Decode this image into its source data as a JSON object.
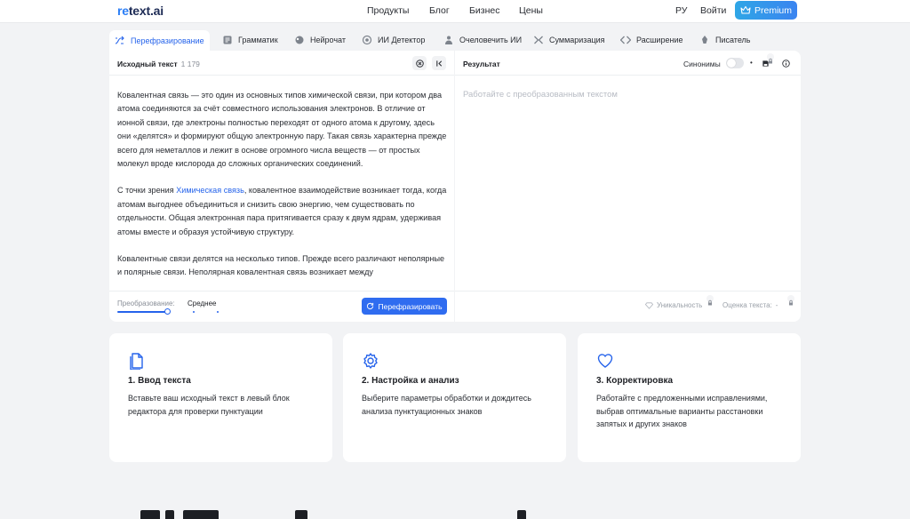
{
  "header": {
    "logo_prefix": "re",
    "logo_rest": "text.ai",
    "nav": [
      "Продукты",
      "Блог",
      "Бизнес",
      "Цены"
    ],
    "lang": "РУ",
    "login": "Войти",
    "premium": "Premium"
  },
  "tabs": [
    {
      "label": "Перефразирование",
      "icon": "paraphrase-icon"
    },
    {
      "label": "Грамматик",
      "icon": "grammar-icon"
    },
    {
      "label": "Нейрочат",
      "icon": "neurochat-icon"
    },
    {
      "label": "ИИ Детектор",
      "icon": "ai-detector-icon"
    },
    {
      "label": "Очеловечить ИИ",
      "icon": "humanize-icon"
    },
    {
      "label": "Суммаризация",
      "icon": "summary-icon"
    },
    {
      "label": "Расширение",
      "icon": "expand-icon"
    },
    {
      "label": "Писатель",
      "icon": "writer-icon"
    }
  ],
  "source": {
    "title": "Исходный текст",
    "count": "1 179",
    "para1": "Ковалентная связь — это один из основных типов химической связи, при котором два атома соединяются за счёт совместного использования электронов. В отличие от ионной связи, где электроны полностью переходят от одного атома к другому, здесь они «делятся» и формируют общую электронную пару. Такая связь характерна прежде всего для неметаллов и лежит в основе огромного числа веществ — от простых молекул вроде кислорода до сложных органических соединений.",
    "para2_before": "С точки зрения ",
    "para2_link": "Химическая связь",
    "para2_after": ", ковалентное взаимодействие возникает тогда, когда атомам выгоднее объединиться и снизить свою энергию, чем существовать по отдельности. Общая электронная пара притягивается сразу к двум ядрам, удерживая атомы вместе и образуя устойчивую структуру.",
    "para3": "Ковалентные связи делятся на несколько типов. Прежде всего различают неполярные и полярные связи. Неполярная ковалентная связь возникает между",
    "mode_label": "Преобразование:",
    "mode_value": "Среднее",
    "mode_level": 0.5,
    "button": "Перефразировать"
  },
  "result": {
    "title": "Результат",
    "synonyms": "Синонимы",
    "placeholder": "Работайте с преобразованным текстом",
    "uniqueness": "Уникальность",
    "score_label": "Оценка текста:",
    "score_value": "-"
  },
  "cards": [
    {
      "title": "1. Ввод текста",
      "desc": "Вставьте ваш исходный текст в левый блок редактора для проверки пунктуации",
      "icon": "document-icon"
    },
    {
      "title": "2. Настройка и анализ",
      "desc": "Выберите параметры обработки и дождитесь анализа пунктуационных знаков",
      "icon": "settings-icon"
    },
    {
      "title": "3. Корректировка",
      "desc": "Работайте с предложенными исправлениями, выбрав оптимальные варианты расстановки запятых и других знаков",
      "icon": "heart-icon"
    }
  ],
  "colors": {
    "accent": "#2563eb",
    "premium_from": "#2fa6e6",
    "premium_to": "#3a84f0",
    "background": "#f2f3f5"
  }
}
